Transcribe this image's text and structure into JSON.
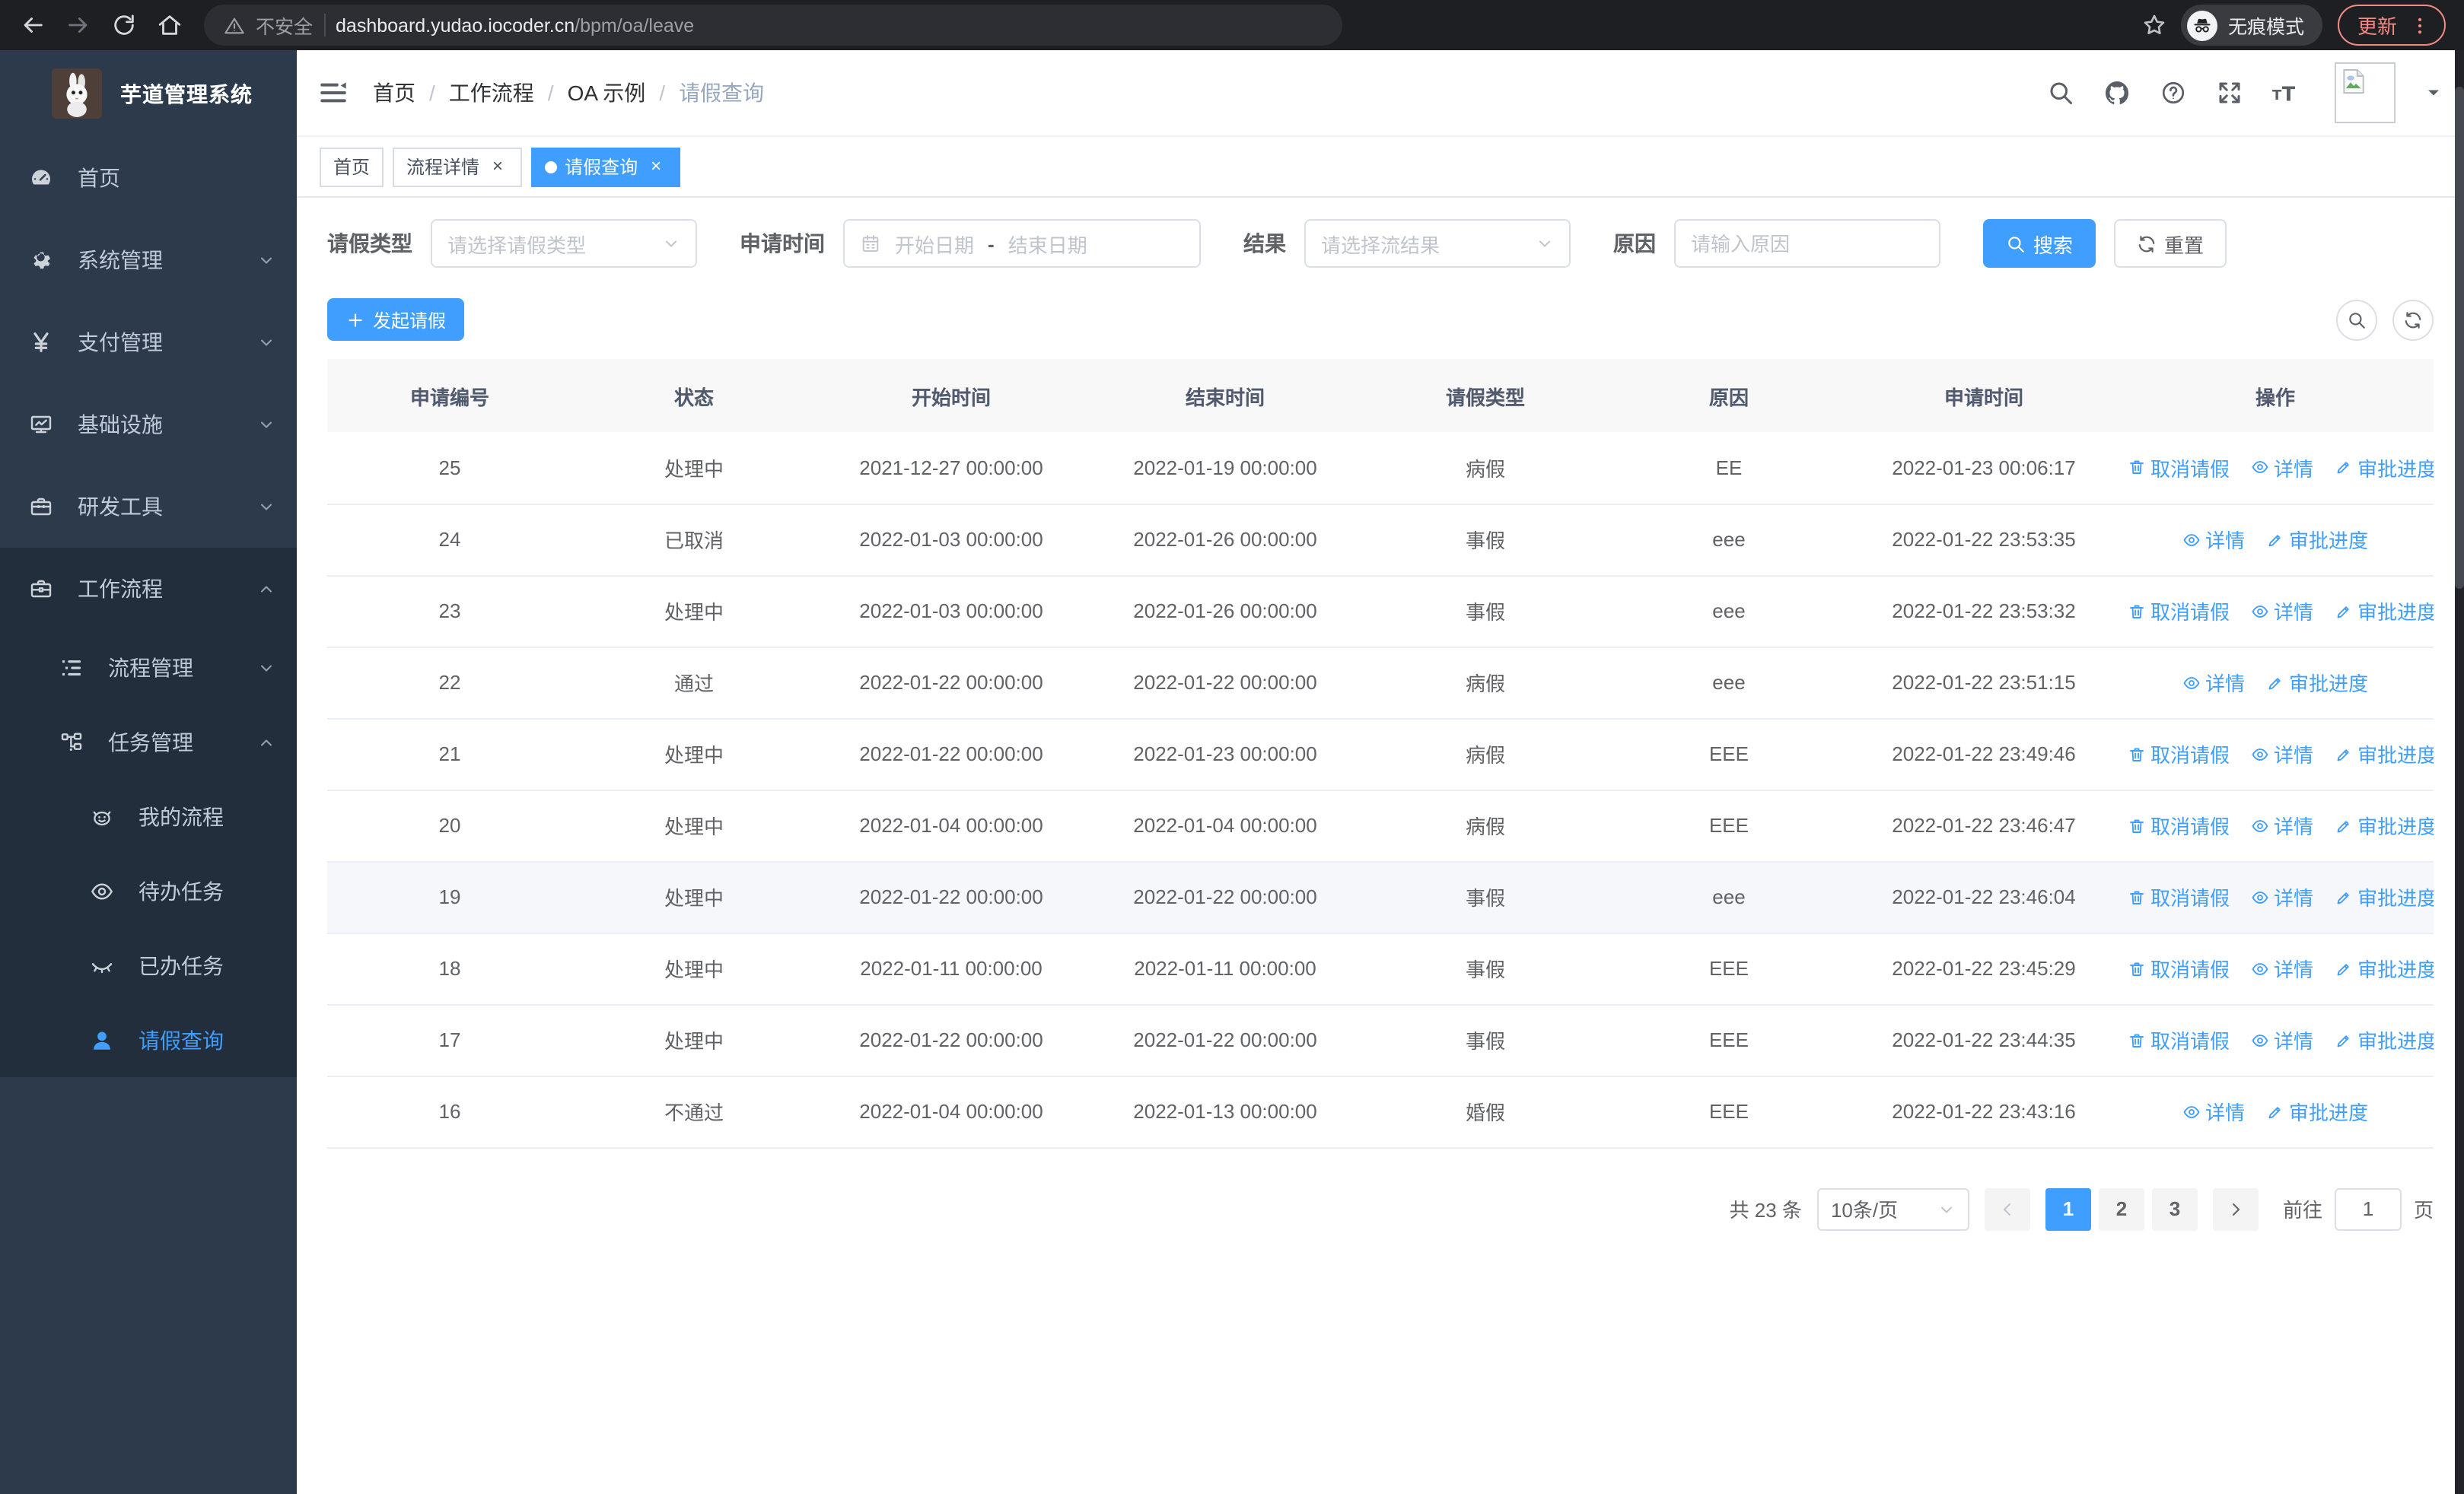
{
  "theme": {
    "primary": "#409eff",
    "sidebar_bg": "#2d3a4b",
    "sidebar_open_bg": "#232e3d",
    "update_accent": "#f28b82"
  },
  "browser": {
    "security_label": "不安全",
    "url_host": "dashboard.yudao.iocoder.cn",
    "url_path": "/bpm/oa/leave",
    "incognito_label": "无痕模式",
    "update_label": "更新"
  },
  "sidebar": {
    "title": "芋道管理系统",
    "items": [
      {
        "key": "home",
        "icon": "dashboard",
        "label": "首页",
        "level": 1
      },
      {
        "key": "system",
        "icon": "gear",
        "label": "系统管理",
        "level": 1,
        "chevron": "down"
      },
      {
        "key": "payment",
        "icon": "yen",
        "label": "支付管理",
        "level": 1,
        "chevron": "down"
      },
      {
        "key": "infra",
        "icon": "monitor",
        "label": "基础设施",
        "level": 1,
        "chevron": "down"
      },
      {
        "key": "devtools",
        "icon": "toolbox",
        "label": "研发工具",
        "level": 1,
        "chevron": "down"
      },
      {
        "key": "workflow",
        "icon": "briefcase",
        "label": "工作流程",
        "level": 1,
        "chevron": "up",
        "open": true
      },
      {
        "key": "process-mgmt",
        "icon": "tree-list",
        "label": "流程管理",
        "level": 2,
        "chevron": "down",
        "open": true
      },
      {
        "key": "task-mgmt",
        "icon": "flow",
        "label": "任务管理",
        "level": 2,
        "chevron": "up",
        "open": true
      },
      {
        "key": "my-process",
        "icon": "robot",
        "label": "我的流程",
        "level": 3,
        "open": true
      },
      {
        "key": "todo-task",
        "icon": "eye",
        "label": "待办任务",
        "level": 3,
        "open": true
      },
      {
        "key": "done-task",
        "icon": "eye-closed",
        "label": "已办任务",
        "level": 3,
        "open": true
      },
      {
        "key": "leave-query",
        "icon": "user",
        "label": "请假查询",
        "level": 3,
        "open": true,
        "active": true
      }
    ]
  },
  "breadcrumb": {
    "items": [
      "首页",
      "工作流程",
      "OA 示例",
      "请假查询"
    ]
  },
  "tags": [
    {
      "label": "首页",
      "closable": false,
      "active": false
    },
    {
      "label": "流程详情",
      "closable": true,
      "active": false
    },
    {
      "label": "请假查询",
      "closable": true,
      "active": true
    }
  ],
  "filters": {
    "leave_type_label": "请假类型",
    "leave_type_placeholder": "请选择请假类型",
    "apply_time_label": "申请时间",
    "date_start_placeholder": "开始日期",
    "date_separator": "-",
    "date_end_placeholder": "结束日期",
    "result_label": "结果",
    "result_placeholder": "请选择流结果",
    "reason_label": "原因",
    "reason_placeholder": "请输入原因",
    "search_label": "搜索",
    "reset_label": "重置"
  },
  "toolbar": {
    "create_label": "发起请假"
  },
  "table": {
    "headers": [
      "申请编号",
      "状态",
      "开始时间",
      "结束时间",
      "请假类型",
      "原因",
      "申请时间",
      "操作"
    ],
    "action_labels": {
      "cancel": "取消请假",
      "detail": "详情",
      "progress": "审批进度"
    },
    "rows": [
      {
        "id": "25",
        "status": "处理中",
        "start": "2021-12-27 00:00:00",
        "end": "2022-01-19 00:00:00",
        "type": "病假",
        "reason": "EE",
        "applied": "2022-01-23 00:06:17",
        "actions": [
          "cancel",
          "detail",
          "progress"
        ],
        "highlight": false
      },
      {
        "id": "24",
        "status": "已取消",
        "start": "2022-01-03 00:00:00",
        "end": "2022-01-26 00:00:00",
        "type": "事假",
        "reason": "eee",
        "applied": "2022-01-22 23:53:35",
        "actions": [
          "detail",
          "progress"
        ],
        "highlight": false
      },
      {
        "id": "23",
        "status": "处理中",
        "start": "2022-01-03 00:00:00",
        "end": "2022-01-26 00:00:00",
        "type": "事假",
        "reason": "eee",
        "applied": "2022-01-22 23:53:32",
        "actions": [
          "cancel",
          "detail",
          "progress"
        ],
        "highlight": false
      },
      {
        "id": "22",
        "status": "通过",
        "start": "2022-01-22 00:00:00",
        "end": "2022-01-22 00:00:00",
        "type": "病假",
        "reason": "eee",
        "applied": "2022-01-22 23:51:15",
        "actions": [
          "detail",
          "progress"
        ],
        "highlight": false
      },
      {
        "id": "21",
        "status": "处理中",
        "start": "2022-01-22 00:00:00",
        "end": "2022-01-23 00:00:00",
        "type": "病假",
        "reason": "EEE",
        "applied": "2022-01-22 23:49:46",
        "actions": [
          "cancel",
          "detail",
          "progress"
        ],
        "highlight": false
      },
      {
        "id": "20",
        "status": "处理中",
        "start": "2022-01-04 00:00:00",
        "end": "2022-01-04 00:00:00",
        "type": "病假",
        "reason": "EEE",
        "applied": "2022-01-22 23:46:47",
        "actions": [
          "cancel",
          "detail",
          "progress"
        ],
        "highlight": false
      },
      {
        "id": "19",
        "status": "处理中",
        "start": "2022-01-22 00:00:00",
        "end": "2022-01-22 00:00:00",
        "type": "事假",
        "reason": "eee",
        "applied": "2022-01-22 23:46:04",
        "actions": [
          "cancel",
          "detail",
          "progress"
        ],
        "highlight": true
      },
      {
        "id": "18",
        "status": "处理中",
        "start": "2022-01-11 00:00:00",
        "end": "2022-01-11 00:00:00",
        "type": "事假",
        "reason": "EEE",
        "applied": "2022-01-22 23:45:29",
        "actions": [
          "cancel",
          "detail",
          "progress"
        ],
        "highlight": false
      },
      {
        "id": "17",
        "status": "处理中",
        "start": "2022-01-22 00:00:00",
        "end": "2022-01-22 00:00:00",
        "type": "事假",
        "reason": "EEE",
        "applied": "2022-01-22 23:44:35",
        "actions": [
          "cancel",
          "detail",
          "progress"
        ],
        "highlight": false
      },
      {
        "id": "16",
        "status": "不通过",
        "start": "2022-01-04 00:00:00",
        "end": "2022-01-13 00:00:00",
        "type": "婚假",
        "reason": "EEE",
        "applied": "2022-01-22 23:43:16",
        "actions": [
          "detail",
          "progress"
        ],
        "highlight": false
      }
    ]
  },
  "pagination": {
    "total_label": "共 23 条",
    "page_size": "10条/页",
    "pages": [
      "1",
      "2",
      "3"
    ],
    "active_page": "1",
    "goto_label": "前往",
    "goto_value": "1",
    "goto_suffix": "页"
  }
}
